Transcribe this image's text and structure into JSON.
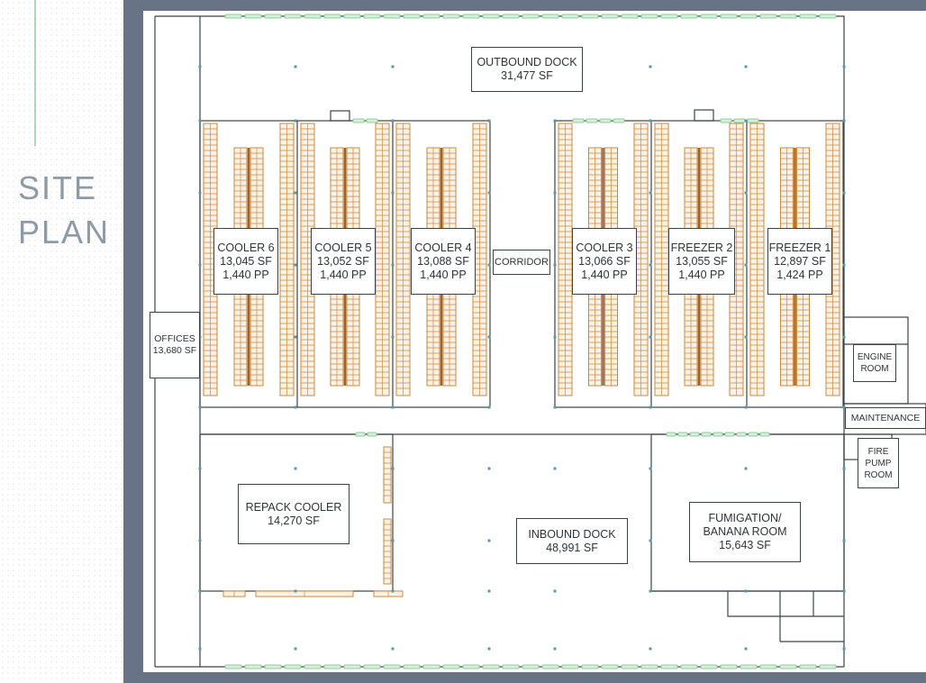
{
  "page_title": {
    "line1": "SITE",
    "line2": "PLAN"
  },
  "rooms": {
    "outbound_dock": {
      "name": "OUTBOUND DOCK",
      "area": "31,477 SF"
    },
    "cooler_6": {
      "name": "COOLER 6",
      "area": "13,045 SF",
      "pallets": "1,440 PP"
    },
    "cooler_5": {
      "name": "COOLER 5",
      "area": "13,052 SF",
      "pallets": "1,440 PP"
    },
    "cooler_4": {
      "name": "COOLER 4",
      "area": "13,088 SF",
      "pallets": "1,440 PP"
    },
    "corridor": {
      "name": "CORRIDOR"
    },
    "cooler_3": {
      "name": "COOLER 3",
      "area": "13,066 SF",
      "pallets": "1,440 PP"
    },
    "freezer_2": {
      "name": "FREEZER 2",
      "area": "13,055 SF",
      "pallets": "1,440 PP"
    },
    "freezer_1": {
      "name": "FREEZER 1",
      "area": "12,897 SF",
      "pallets": "1,424 PP"
    },
    "offices": {
      "name": "OFFICES",
      "area": "13,680 SF"
    },
    "engine_room": {
      "line1": "ENGINE",
      "line2": "ROOM"
    },
    "maintenance": {
      "name": "MAINTENANCE"
    },
    "fire_pump_room": {
      "line1": "FIRE",
      "line2": "PUMP",
      "line3": "ROOM"
    },
    "repack_cooler": {
      "name": "REPACK COOLER",
      "area": "14,270 SF"
    },
    "inbound_dock": {
      "name": "INBOUND DOCK",
      "area": "48,991 SF"
    },
    "fumigation": {
      "line1": "FUMIGATION/",
      "line2": "BANANA ROOM",
      "area": "15,643 SF"
    }
  },
  "colors": {
    "frame": "#687485",
    "wall": "#3d4248",
    "rack": "#c98a3e",
    "rack_fill": "#fbf2e6",
    "dock_door": "#8fcf9b",
    "title": "#8d9aa7",
    "accent": "#a8d8bf"
  }
}
